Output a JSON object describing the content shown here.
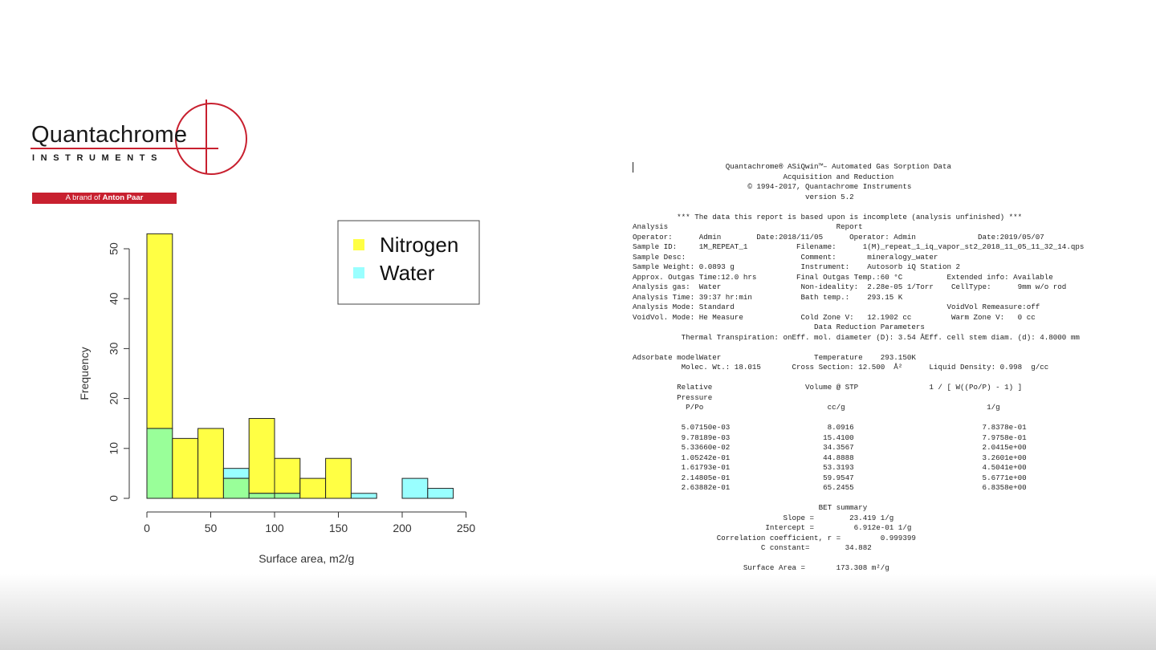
{
  "logo": {
    "brand": "Quantachrome",
    "subtitle": "INSTRUMENTS",
    "band_prefix": "A brand of ",
    "band_name": "Anton Paar",
    "color": "#c8202f"
  },
  "chart_data": {
    "type": "bar",
    "subtype": "overlapping histogram",
    "xlabel": "Surface area, m2/g",
    "ylabel": "Frequency",
    "xlim": [
      0,
      250
    ],
    "ylim": [
      0,
      55
    ],
    "x_ticks": [
      0,
      50,
      100,
      150,
      200,
      250
    ],
    "y_ticks": [
      0,
      10,
      20,
      30,
      40,
      50
    ],
    "legend_position": "top-right",
    "bin_edges": [
      0,
      20,
      40,
      60,
      80,
      100,
      120,
      140,
      160,
      180,
      200,
      220,
      240
    ],
    "series": [
      {
        "name": "Nitrogen",
        "color": "#ffff44",
        "values": [
          53,
          12,
          14,
          4,
          16,
          8,
          4,
          8,
          0,
          0,
          0,
          0
        ]
      },
      {
        "name": "Water",
        "color": "#99ffff",
        "values": [
          14,
          0,
          0,
          6,
          1,
          1,
          0,
          0,
          1,
          0,
          4,
          2
        ]
      }
    ],
    "overlap_color": "#99ff99"
  },
  "report": {
    "lines": [
      "                     Quantachrome® ASiQwin™– Automated Gas Sorption Data",
      "                                  Acquisition and Reduction",
      "                          © 1994-2017, Quantachrome Instruments",
      "                                       version 5.2",
      "",
      "          *** The data this report is based upon is incomplete (analysis unfinished) ***",
      "Analysis                                      Report",
      "Operator:      Admin        Date:2018/11/05      Operator: Admin              Date:2019/05/07",
      "Sample ID:     1M_REPEAT_1           Filename:      1(M)_repeat_1_iq_vapor_st2_2018_11_05_11_32_14.qps",
      "Sample Desc:                          Comment:       mineralogy_water",
      "Sample Weight: 0.0893 g               Instrument:    Autosorb iQ Station 2",
      "Approx. Outgas Time:12.0 hrs         Final Outgas Temp.:60 °C          Extended info: Available",
      "Analysis gas:  Water                  Non-ideality:  2.28e-05 1/Torr    CellType:      9mm w/o rod",
      "Analysis Time: 39:37 hr:min           Bath temp.:    293.15 K",
      "Analysis Mode: Standard                                                VoidVol Remeasure:off",
      "VoidVol. Mode: He Measure             Cold Zone V:   12.1902 cc         Warm Zone V:   0 cc",
      "                                         Data Reduction Parameters",
      "           Thermal Transpiration: onEff. mol. diameter (D): 3.54 ÅEff. cell stem diam. (d): 4.8000 mm",
      "",
      "Adsorbate modelWater                     Temperature    293.150K",
      "           Molec. Wt.: 18.015       Cross Section: 12.500  Å²      Liquid Density: 0.998  g/cc",
      "",
      "          Relative                     Volume @ STP                1 / [ W((Po/P) - 1) ]",
      "          Pressure",
      "            P/Po                            cc/g                                1/g",
      "",
      "           5.07150e-03                      8.0916                             7.8378e-01",
      "           9.78189e-03                     15.4100                             7.9758e-01",
      "           5.33660e-02                     34.3567                             2.0415e+00",
      "           1.05242e-01                     44.8888                             3.2601e+00",
      "           1.61793e-01                     53.3193                             4.5041e+00",
      "           2.14805e-01                     59.9547                             5.6771e+00",
      "           2.63882e-01                     65.2455                             6.8358e+00",
      "",
      "                                          BET summary",
      "                                  Slope =        23.419 1/g",
      "                              Intercept =         6.912e-01 1/g",
      "                   Correlation coefficient, r =         0.999399",
      "                             C constant=        34.882",
      "",
      "                         Surface Area =       173.308 m²/g"
    ]
  }
}
